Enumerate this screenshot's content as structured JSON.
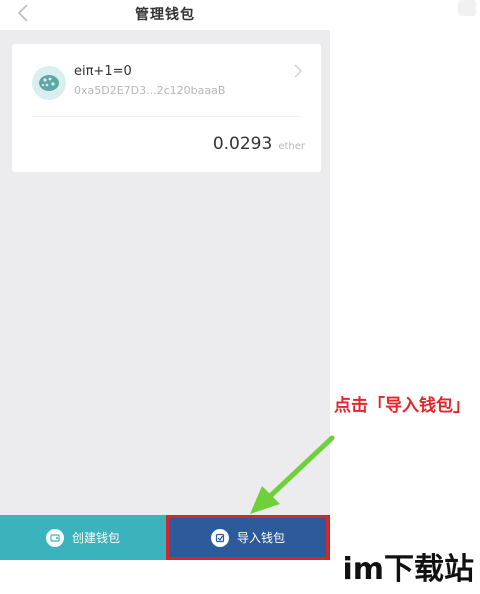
{
  "navbar": {
    "title": "管理钱包",
    "back_icon": "chevron-left-icon"
  },
  "wallet": {
    "name": "eiπ+1=0",
    "address": "0xa5D2E7D3...2c120baaaB",
    "balance": "0.0293",
    "unit": "ether",
    "avatar_icon": "wallet-avatar-icon"
  },
  "bottom": {
    "create_label": "创建钱包",
    "import_label": "导入钱包"
  },
  "annotation": {
    "text": "点击「导入钱包」"
  },
  "watermark": {
    "text": "im下载站"
  },
  "colors": {
    "create_bg": "#3bb3bd",
    "import_bg": "#2d5a9b",
    "highlight": "#d4262b",
    "arrow": "#6fd139",
    "annotation": "#e1262c"
  }
}
